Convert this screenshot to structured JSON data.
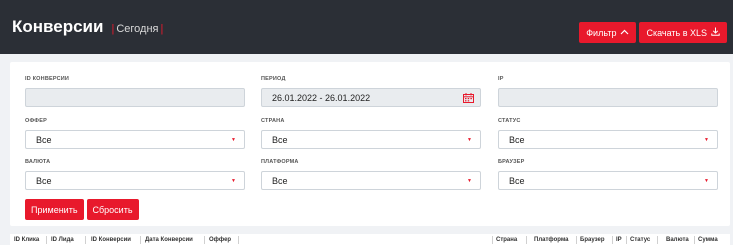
{
  "header": {
    "title": "Конверсии",
    "separator": "|",
    "subtitle": "Сегодня",
    "filter_label": "Фильтр",
    "download_label": "Скачать в XLS"
  },
  "filters": {
    "conversion_id": {
      "label": "ID КОНВЕРСИИ",
      "value": ""
    },
    "period": {
      "label": "ПЕРИОД",
      "value": "26.01.2022 - 26.01.2022"
    },
    "ip": {
      "label": "IP",
      "value": ""
    },
    "offer": {
      "label": "ОФФЕР",
      "value": "Все"
    },
    "country": {
      "label": "СТРАНА",
      "value": "Все"
    },
    "status": {
      "label": "СТАТУС",
      "value": "Все"
    },
    "currency": {
      "label": "ВАЛЮТА",
      "value": "Все"
    },
    "platform": {
      "label": "ПЛАТФОРМА",
      "value": "Все"
    },
    "browser": {
      "label": "БРАУЗЕР",
      "value": "Все"
    }
  },
  "actions": {
    "apply_label": "Применить",
    "reset_label": "Сбросить"
  },
  "table": {
    "columns": [
      "ID Клика",
      "ID Лида",
      "ID Конверсии",
      "Дата Конверсии",
      "Оффер",
      "Страна",
      "Платформа",
      "Браузер",
      "IP",
      "Статус",
      "Валюта",
      "Сумма"
    ]
  },
  "colors": {
    "accent": "#e8192c",
    "header_bg": "#2b2f36"
  },
  "icons": {
    "filter": "chevron-up-icon",
    "download": "download-icon",
    "select": "caret-down-icon",
    "period": "calendar-icon"
  }
}
